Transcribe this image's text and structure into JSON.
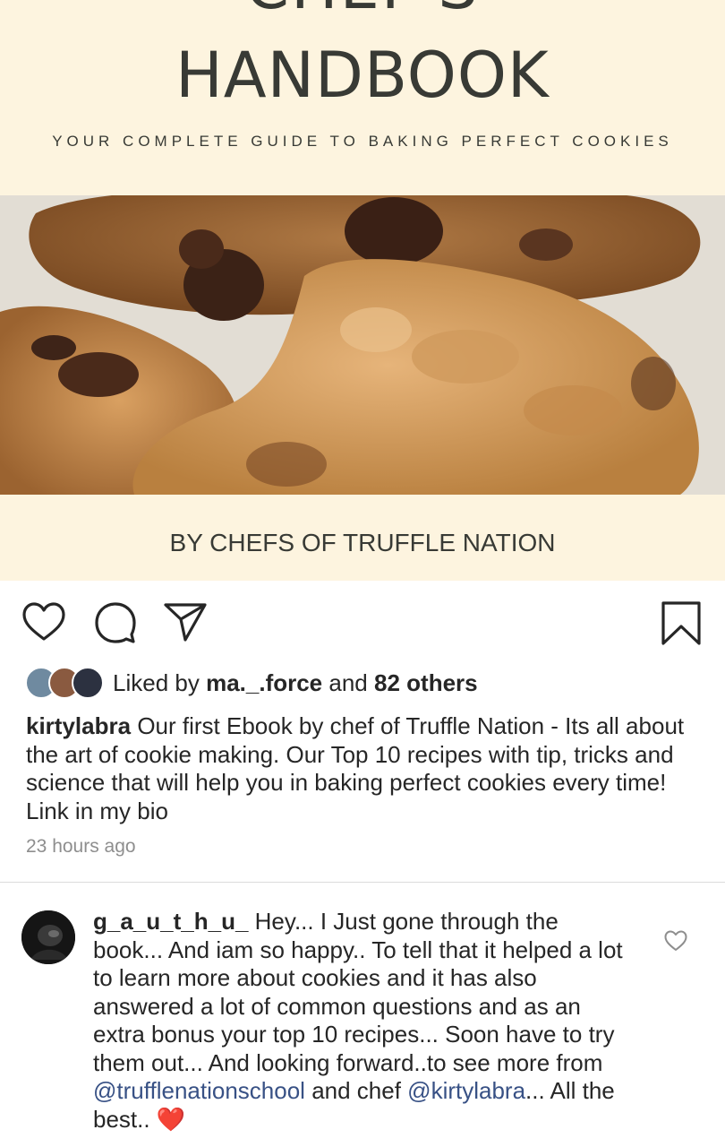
{
  "post": {
    "cover": {
      "title_partial": "CHEF'S",
      "title": "HANDBOOK",
      "subtitle": "YOUR COMPLETE GUIDE TO BAKING PERFECT COOKIES",
      "byline": "BY CHEFS OF TRUFFLE NATION"
    },
    "actions": {
      "like_icon": "heart-icon",
      "comment_icon": "comment-icon",
      "share_icon": "send-icon",
      "save_icon": "bookmark-icon"
    },
    "likes": {
      "prefix": "Liked by",
      "user": "ma._.force",
      "joiner": "and",
      "others": "82 others"
    },
    "caption": {
      "username": "kirtylabra",
      "text": "Our first Ebook by chef of Truffle Nation - Its all about the art of cookie making. Our Top 10 recipes with tip, tricks and science that will help you in baking perfect cookies every time! Link in my bio"
    },
    "timestamp": "23 hours ago"
  },
  "comment": {
    "username": "g_a_u_t_h_u_",
    "text_1": "Hey... I Just gone through the book... And iam so happy.. To tell that it helped a lot to learn more about cookies and it has also answered a lot of common questions and as an extra bonus your top 10 recipes... Soon have to try them out... And looking forward..to see more from",
    "mention_1": "@trufflenationschool",
    "text_2": "and chef",
    "mention_2": "@kirtylabra",
    "text_3": "... All the best..",
    "emoji": "❤️"
  },
  "colors": {
    "cover_bg": "#fdf4df",
    "cover_text": "#383a35",
    "link": "#385185",
    "muted": "#8e8e8e"
  }
}
